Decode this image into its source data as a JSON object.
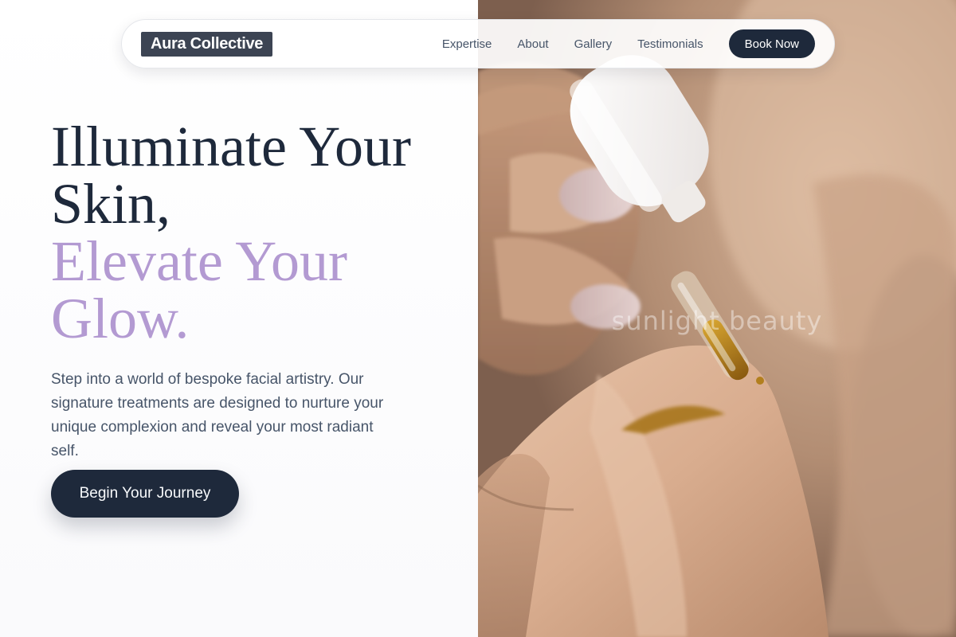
{
  "brand": {
    "name": "Aura Collective"
  },
  "nav": {
    "links": [
      "Expertise",
      "About",
      "Gallery",
      "Testimonials"
    ],
    "cta_label": "Book Now"
  },
  "hero": {
    "headline_line1": "Illuminate Your Skin,",
    "headline_line2": "Elevate Your Glow.",
    "subtitle": "Step into a world of bespoke facial artistry. Our signature treatments are designed to nurture your unique complexion and reveal your most radiant self.",
    "cta_label": "Begin Your Journey"
  },
  "image": {
    "subject": "hand-applying-serum-dropper",
    "watermark": "sunlight beauty"
  },
  "colors": {
    "primary_dark": "#1e293b",
    "accent_lavender": "#b39ad2",
    "body_text": "#475569",
    "logo_bg": "#3c4453"
  }
}
